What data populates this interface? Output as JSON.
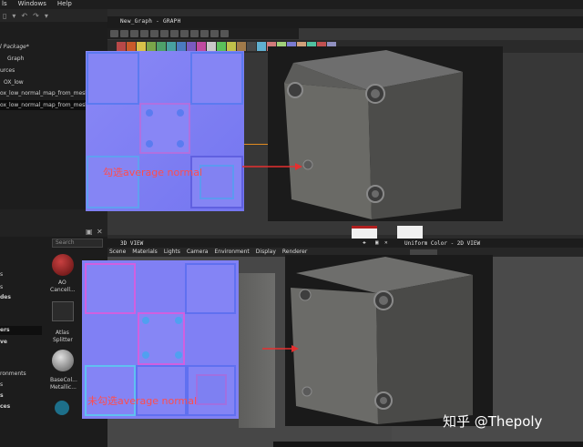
{
  "menubar": {
    "items": [
      "ls",
      "Windows",
      "Help"
    ]
  },
  "explorer": {
    "items": [
      "l Package*",
      "Graph",
      "urces",
      "OX_low",
      "ox_low_normal_map_from_mesh_t",
      "ox_low_normal_map_from_mesh"
    ]
  },
  "graph": {
    "title": "New_Graph - GRAPH"
  },
  "library": {
    "search_placeholder": "Search",
    "categories": [
      "s",
      "s",
      "des",
      "ers",
      "ve",
      "ronments",
      "s",
      "s",
      "ces"
    ],
    "items": [
      {
        "label1": "AO",
        "label2": "Cancell..."
      },
      {
        "label1": "Atlas",
        "label2": "Splitter"
      },
      {
        "label1": "BaseCol...",
        "label2": "Metallic..."
      }
    ]
  },
  "view3d": {
    "title": "3D VIEW",
    "menu": [
      "Scene",
      "Materials",
      "Lights",
      "Camera",
      "Environment",
      "Display",
      "Renderer"
    ]
  },
  "view2d": {
    "title": "Uniform Color - 2D VIEW"
  },
  "annotations": {
    "top_caption": "勾选average normal",
    "bottom_caption": "未勾选average normal"
  },
  "watermark": "知乎 @Thepoly",
  "colors": {
    "caption": "#ff4d4d",
    "arrow": "#e53030",
    "normal_base": "#7b7ff4",
    "connector": "#e08a20"
  },
  "swatches": [
    "#b84848",
    "#c95a2a",
    "#d8c14a",
    "#7aa54a",
    "#4ea06a",
    "#48a0a0",
    "#4a7ac0",
    "#7a5ac0",
    "#c04aa0",
    "#c8c8c8",
    "#5ac05a",
    "#c0c04a",
    "#a07a4a",
    "#4a4a4a",
    "#60b0d0",
    "#d07a7a",
    "#a0d07a",
    "#7a7ad0",
    "#d0a07a",
    "#50c0a0",
    "#c05050",
    "#9090c0"
  ]
}
